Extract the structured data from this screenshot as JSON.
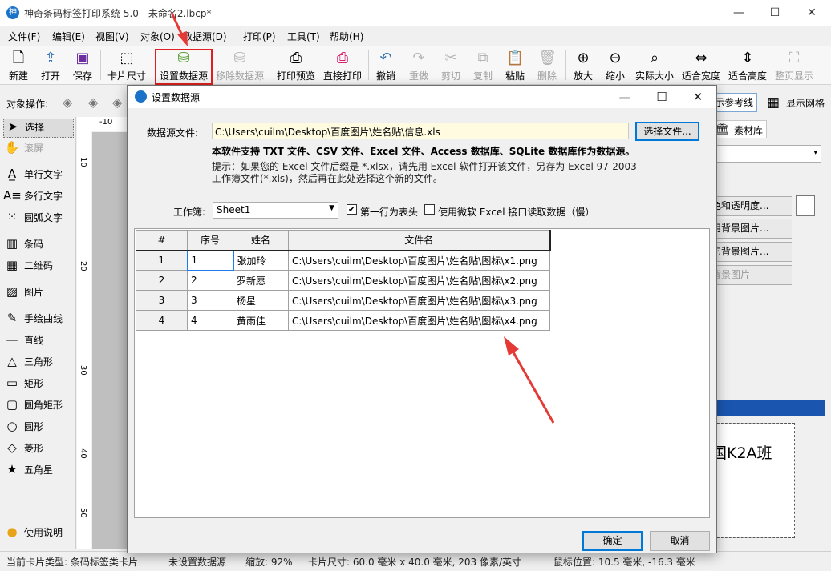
{
  "app": {
    "title": "神奇条码标签打印系统 5.0 - 未命名2.lbcp*",
    "icon_letter": "神"
  },
  "window_controls": {
    "minimize": "—",
    "maximize": "☐",
    "close": "✕"
  },
  "menu": [
    "文件(F)",
    "编辑(E)",
    "视图(V)",
    "对象(O)",
    "数据源(D)",
    "打印(P)",
    "工具(T)",
    "帮助(H)"
  ],
  "toolbar": {
    "new": "新建",
    "open": "打开",
    "save": "保存",
    "card_size": "卡片尺寸",
    "set_datasource": "设置数据源",
    "remove_datasource": "移除数据源",
    "print_preview": "打印预览",
    "direct_print": "直接打印",
    "undo": "撤销",
    "redo": "重做",
    "cut": "剪切",
    "copy": "复制",
    "paste": "粘贴",
    "delete": "删除",
    "zoom_in": "放大",
    "zoom_out": "缩小",
    "actual_size": "实际大小",
    "fit_width": "适合宽度",
    "fit_height": "适合高度",
    "full_page": "整页显示"
  },
  "objbar": {
    "label": "对象操作:"
  },
  "tools": {
    "select": "选择",
    "scroll": "滚屏",
    "single_text": "单行文字",
    "multi_text": "多行文字",
    "arc_text": "圆弧文字",
    "barcode": "条码",
    "qrcode": "二维码",
    "image": "图片",
    "freehand": "手绘曲线",
    "line": "直线",
    "triangle": "三角形",
    "rect": "矩形",
    "round_rect": "圆角矩形",
    "circle": "圆形",
    "diamond": "菱形",
    "star": "五角星",
    "help": "使用说明"
  },
  "ruler": {
    "top": "-10",
    "left": [
      "10",
      "20",
      "30",
      "40",
      "50"
    ]
  },
  "rightpanel": {
    "show_guides": "示参考线",
    "show_grid": "显示网格",
    "material_tab": "素材库",
    "btn1": "色和透明度...",
    "btn2": "用背景图片...",
    "btn3": "它背景图片...",
    "btn4": "背景图片",
    "preview_text": "国K2A班"
  },
  "status": {
    "card_type": "当前卡片类型: 条码标签类卡片",
    "datasource": "未设置数据源",
    "zoom": "缩放: 92%",
    "card_size": "卡片尺寸: 60.0 毫米 x 40.0 毫米, 203 像素/英寸",
    "mouse_pos": "鼠标位置: 10.5 毫米, -16.3 毫米"
  },
  "dialog": {
    "title": "设置数据源",
    "file_label": "数据源文件:",
    "file_path": "C:\\Users\\cuilm\\Desktop\\百度图片\\姓名贴\\信息.xls",
    "choose_file": "选择文件...",
    "support_text": "本软件支持 TXT 文件、CSV 文件、Excel 文件、Access 数据库、SQLite 数据库作为数据源。",
    "hint_line1": "提示：如果您的 Excel 文件后缀是 *.xlsx，请先用 Excel 软件打开该文件，另存为 Excel 97-2003",
    "hint_line2": "工作簿文件(*.xls)，然后再在此处选择这个新的文件。",
    "workbook_label": "工作簿:",
    "workbook_value": "Sheet1",
    "first_row_header": "第一行为表头",
    "first_row_checked": "✔",
    "use_ms_excel": "使用微软 Excel 接口读取数据（慢）",
    "columns": [
      "#",
      "序号",
      "姓名",
      "文件名"
    ],
    "rows": [
      [
        "1",
        "1",
        "张加玲",
        "C:\\Users\\cuilm\\Desktop\\百度图片\\姓名贴\\图标\\x1.png"
      ],
      [
        "2",
        "2",
        "罗新愿",
        "C:\\Users\\cuilm\\Desktop\\百度图片\\姓名贴\\图标\\x2.png"
      ],
      [
        "3",
        "3",
        "杨星",
        "C:\\Users\\cuilm\\Desktop\\百度图片\\姓名贴\\图标\\x3.png"
      ],
      [
        "4",
        "4",
        "黄雨佳",
        "C:\\Users\\cuilm\\Desktop\\百度图片\\姓名贴\\图标\\x4.png"
      ]
    ],
    "ok": "确定",
    "cancel": "取消"
  },
  "colors": {
    "annotation_red": "#e53935",
    "accent_blue": "#0078d7",
    "path_bg": "#fffbe0"
  }
}
